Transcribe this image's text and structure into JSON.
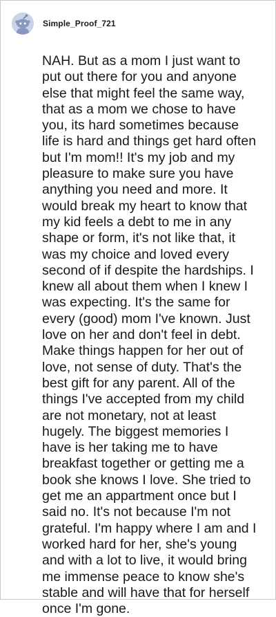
{
  "comment": {
    "username": "Simple_Proof_721",
    "avatar_icon": "snoo-avatar-icon",
    "body": "NAH. But as a mom I just want to put out there for you and anyone else that might feel the same way, that as a mom we chose to have you, its hard sometimes because life is hard and things get hard often but I'm mom!! It's my job and my pleasure to make sure you have anything you need and more. It would break my heart to know that my kid feels a debt to me in any shape or form, it's not like that, it was my choice and loved every second of if despite the hardships. I knew all about them when I knew I was expecting. It's the same for every (good) mom I've known. Just love on her and don't feel in debt. Make things happen for her out of love, not sense of duty. That's the best gift for any parent. All of the things I've accepted from my child are not monetary, not at least hugely. The biggest memories I have is her taking me to have breakfast together or getting me a book she knows I love. She tried to get me an appartment once but I said no. It's not because I'm not grateful. I'm happy where I am and I worked hard for her, she's young and with a lot to live, it would bring me immense peace to know she's stable and will have that for herself once I'm gone."
  },
  "colors": {
    "avatar_background": "#c9d4e6",
    "text": "#1a1a1b",
    "border": "#c9c9c9"
  }
}
